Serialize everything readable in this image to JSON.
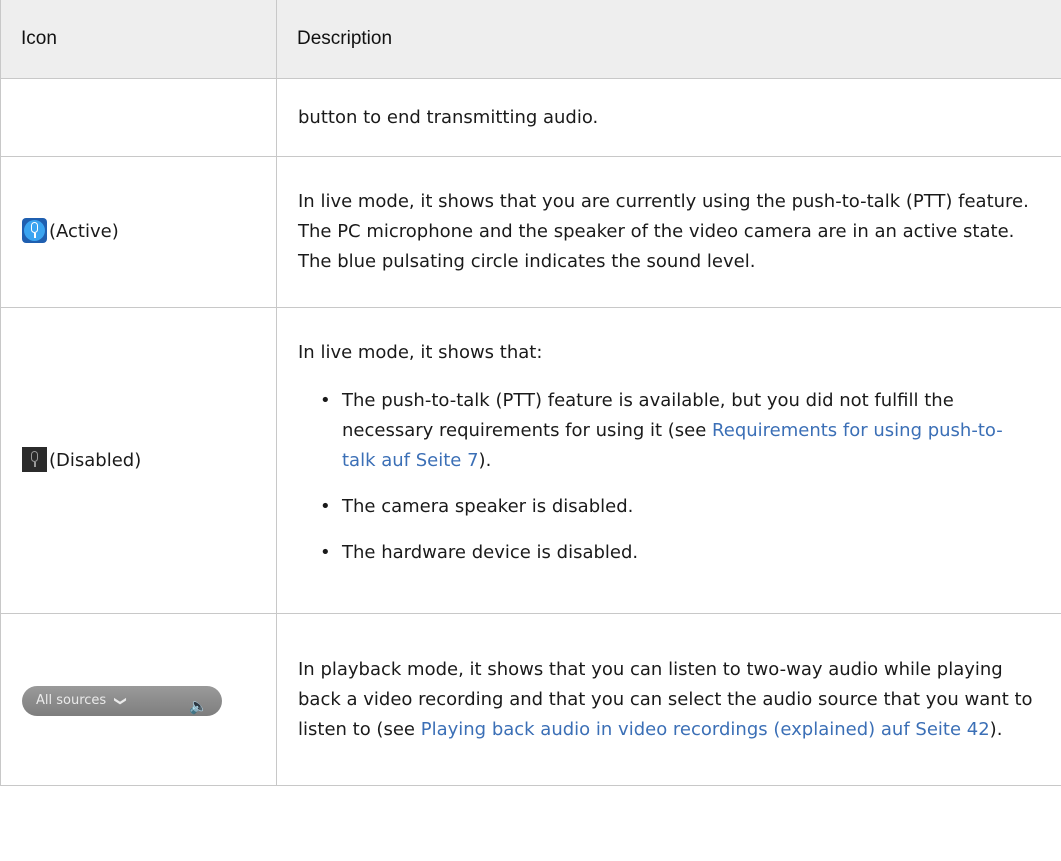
{
  "header": {
    "col_icon": "Icon",
    "col_description": "Description"
  },
  "rows": [
    {
      "icon_name": "none",
      "icon_label": "",
      "text": "button to end transmitting audio."
    },
    {
      "icon_name": "microphone-active-icon",
      "icon_label": "(Active)",
      "text": "In live mode, it shows that you are currently using the push-to-talk (PTT) feature. The PC microphone and the speaker of the video camera are in an active state. The blue pulsating circle indicates the sound level."
    },
    {
      "icon_name": "microphone-disabled-icon",
      "icon_label": "(Disabled)",
      "intro": "In live mode, it shows that:",
      "bullets": [
        {
          "text": "The push-to-talk (PTT) feature is available, but you did not fulfill the necessary requirements for using it (see ",
          "link": "Requirements for using push-to-talk auf Seite 7",
          "after": ")."
        },
        {
          "text": "The camera speaker is disabled."
        },
        {
          "text": "The hardware device is disabled."
        }
      ]
    },
    {
      "icon_name": "audio-source-selector-icon",
      "icon_pill_label": "All sources",
      "text": "In playback mode, it shows that you can listen to two-way audio while playing back a video recording and that you can select the audio source that you want to listen to (see ",
      "link": "Playing back audio in video recordings (explained) auf Seite 42",
      "after": ")."
    }
  ],
  "colors": {
    "link": "#3b6fb6",
    "header_bg": "#eeeeee",
    "border": "#c8c8c8",
    "active_mic": "#3aa4f0"
  }
}
